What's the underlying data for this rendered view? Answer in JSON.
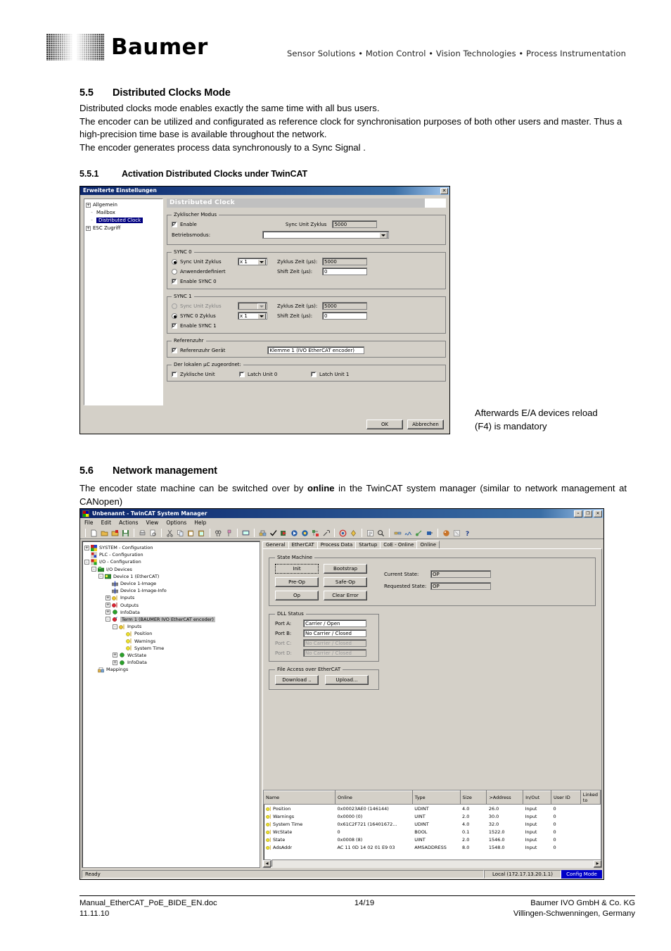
{
  "header": {
    "brand": "Baumer",
    "tagline": "Sensor Solutions • Motion Control • Vision Technologies • Process Instrumentation"
  },
  "sections": {
    "s55": {
      "number": "5.5",
      "title": "Distributed Clocks Mode",
      "p1": "Distributed clocks mode enables exactly the same time with all bus users.",
      "p2": "The encoder can be utilized and configurated as reference clock for synchronisation purposes of both other users and master. Thus a high-precision time base is available throughout the network.",
      "p3": "The encoder generates process data synchronously to a Sync Signal ."
    },
    "s551": {
      "number": "5.5.1",
      "title": "Activation Distributed Clocks under TwinCAT"
    },
    "s56": {
      "number": "5.6",
      "title": "Network management",
      "p1a": "The encoder state machine can be switched over by ",
      "p1b": "online",
      "p1c": " in the TwinCAT system manager (similar to network management at CANopen)"
    }
  },
  "note": "Afterwards E/A devices reload\n(F4) is mandatory",
  "dialog1": {
    "title": "Erweiterte Einstellungen",
    "close_label": "✕",
    "tree": [
      {
        "label": "Allgemein",
        "expander": "+",
        "selected": false
      },
      {
        "label": "Mailbox",
        "expander": "",
        "selected": false
      },
      {
        "label": "Distributed Clock",
        "expander": "",
        "selected": true
      },
      {
        "label": "ESC Zugriff",
        "expander": "+",
        "selected": false
      }
    ],
    "pane_title": "Distributed Clock",
    "cyclic": {
      "legend": "Zyklischer Modus",
      "enable_label": "Enable",
      "enable_checked": true,
      "sync_unit_cycle_label": "Sync Unit Zyklus",
      "sync_unit_cycle_value": "5000",
      "mode_label": "Betriebsmodus:",
      "mode_value": ""
    },
    "sync0": {
      "legend": "SYNC 0",
      "opt1_label": "Sync Unit Zyklus",
      "opt1_selected": true,
      "opt1_combo": "x 1",
      "opt2_label": "Anwenderdefiniert",
      "opt2_selected": false,
      "cycle_time_label": "Zyklus Zeit (µs):",
      "cycle_time_value": "5000",
      "shift_time_label": "Shift Zeit (µs):",
      "shift_time_value": "0",
      "enable_label": "Enable SYNC 0",
      "enable_checked": true
    },
    "sync1": {
      "legend": "SYNC 1",
      "opt1_label": "Sync Unit Zyklus",
      "opt1_selected": false,
      "opt1_combo": "",
      "opt2_label": "SYNC 0 Zyklus",
      "opt2_selected": true,
      "opt2_combo": "x 1",
      "cycle_time_label": "Zyklus Zeit (µs):",
      "cycle_time_value": "5000",
      "shift_time_label": "Shift Zeit (µs):",
      "shift_time_value": "0",
      "enable_label": "Enable SYNC 1",
      "enable_checked": true
    },
    "refclock": {
      "legend": "Referenzuhr",
      "device_label": "Referenzuhr Gerät",
      "device_checked": true,
      "device_value": "Klemme 1 (IVO EtherCAT encoder)"
    },
    "localuc": {
      "legend": "Der lokalen µC zugeordnet:",
      "items": [
        {
          "label": "Zyklische Unit",
          "checked": false
        },
        {
          "label": "Latch Unit 0",
          "checked": false
        },
        {
          "label": "Latch Unit 1",
          "checked": false
        }
      ]
    },
    "ok_label": "OK",
    "cancel_label": "Abbrechen"
  },
  "twincat": {
    "title": "Unbenannt - TwinCAT System Manager",
    "window_buttons": [
      "–",
      "❐",
      "✕"
    ],
    "menu": [
      "File",
      "Edit",
      "Actions",
      "View",
      "Options",
      "Help"
    ],
    "tree": [
      {
        "depth": 0,
        "expander": "+",
        "label": "SYSTEM - Configuration",
        "icon": "system-icon",
        "selected": false
      },
      {
        "depth": 0,
        "expander": "",
        "label": "PLC - Configuration",
        "icon": "plc-icon",
        "selected": false
      },
      {
        "depth": 0,
        "expander": "-",
        "label": "I/O - Configuration",
        "icon": "io-icon",
        "selected": false
      },
      {
        "depth": 1,
        "expander": "-",
        "label": "I/O Devices",
        "icon": "devices-icon",
        "selected": false
      },
      {
        "depth": 2,
        "expander": "-",
        "label": "Device 1 (EtherCAT)",
        "icon": "device-icon",
        "selected": false
      },
      {
        "depth": 3,
        "expander": "",
        "label": "Device 1-Image",
        "icon": "image-icon",
        "selected": false
      },
      {
        "depth": 3,
        "expander": "",
        "label": "Device 1-Image-Info",
        "icon": "image-icon",
        "selected": false
      },
      {
        "depth": 3,
        "expander": "+",
        "label": "Inputs",
        "icon": "inputs-icon",
        "selected": false
      },
      {
        "depth": 3,
        "expander": "+",
        "label": "Outputs",
        "icon": "outputs-icon",
        "selected": false
      },
      {
        "depth": 3,
        "expander": "+",
        "label": "InfoData",
        "icon": "infodata-icon",
        "selected": false
      },
      {
        "depth": 3,
        "expander": "-",
        "label": "Term 1 (BAUMER IVO EtherCAT encoder)",
        "icon": "term-icon",
        "selected": true
      },
      {
        "depth": 4,
        "expander": "-",
        "label": "Inputs",
        "icon": "inputs-icon",
        "selected": false
      },
      {
        "depth": 5,
        "expander": "",
        "label": "Position",
        "icon": "var-icon",
        "selected": false
      },
      {
        "depth": 5,
        "expander": "",
        "label": "Warnings",
        "icon": "var-icon",
        "selected": false
      },
      {
        "depth": 5,
        "expander": "",
        "label": "System Time",
        "icon": "var-icon",
        "selected": false
      },
      {
        "depth": 4,
        "expander": "+",
        "label": "WcState",
        "icon": "infodata-icon",
        "selected": false
      },
      {
        "depth": 4,
        "expander": "+",
        "label": "InfoData",
        "icon": "infodata-icon",
        "selected": false
      },
      {
        "depth": 1,
        "expander": "",
        "label": "Mappings",
        "icon": "mappings-icon",
        "selected": false
      }
    ],
    "tabs": [
      {
        "label": "General",
        "active": false
      },
      {
        "label": "EtherCAT",
        "active": false
      },
      {
        "label": "Process Data",
        "active": false
      },
      {
        "label": "Startup",
        "active": false
      },
      {
        "label": "CoE - Online",
        "active": false
      },
      {
        "label": "Online",
        "active": true
      }
    ],
    "state_machine": {
      "legend": "State Machine",
      "buttons": [
        "Init",
        "Bootstrap",
        "Pre-Op",
        "Safe-Op",
        "Op",
        "Clear Error"
      ],
      "current_state_label": "Current State:",
      "current_state_value": "OP",
      "requested_state_label": "Requested State:",
      "requested_state_value": "OP"
    },
    "dll_status": {
      "legend": "DLL Status",
      "ports": [
        {
          "label": "Port A:",
          "value": "Carrier / Open",
          "disabled": false
        },
        {
          "label": "Port B:",
          "value": "No Carrier / Closed",
          "disabled": false
        },
        {
          "label": "Port C:",
          "value": "No Carrier / Closed",
          "disabled": true
        },
        {
          "label": "Port D:",
          "value": "No Carrier / Closed",
          "disabled": true
        }
      ]
    },
    "file_access": {
      "legend": "File Access over EtherCAT",
      "download_label": "Download ..",
      "upload_label": "Upload..."
    },
    "grid": {
      "columns": [
        "Name",
        "Online",
        "Type",
        "Size",
        ">Address",
        "In/Out",
        "User ID",
        "Linked to"
      ],
      "rows": [
        {
          "name": "Position",
          "online": "0x00023AE0 (146144)",
          "type": "UDINT",
          "size": "4.0",
          "address": "26.0",
          "inout": "Input",
          "userid": "0",
          "linked": ""
        },
        {
          "name": "Warnings",
          "online": "0x0000 (0)",
          "type": "UINT",
          "size": "2.0",
          "address": "30.0",
          "inout": "Input",
          "userid": "0",
          "linked": ""
        },
        {
          "name": "System Time",
          "online": "0x61C2F721 (16401672...",
          "type": "UDINT",
          "size": "4.0",
          "address": "32.0",
          "inout": "Input",
          "userid": "0",
          "linked": ""
        },
        {
          "name": "WcState",
          "online": "0",
          "type": "BOOL",
          "size": "0.1",
          "address": "1522.0",
          "inout": "Input",
          "userid": "0",
          "linked": ""
        },
        {
          "name": "State",
          "online": "0x0008 (8)",
          "type": "UINT",
          "size": "2.0",
          "address": "1546.0",
          "inout": "Input",
          "userid": "0",
          "linked": ""
        },
        {
          "name": "AdsAddr",
          "online": "AC 11 0D 14 02 01 E9 03",
          "type": "AMSADDRESS",
          "size": "8.0",
          "address": "1548.0",
          "inout": "Input",
          "userid": "0",
          "linked": ""
        }
      ]
    },
    "status_bar": {
      "ready": "Ready",
      "local": "Local (172.17.13.20.1.1)",
      "mode": "Config Mode"
    }
  },
  "footer": {
    "doc": "Manual_EtherCAT_PoE_BIDE_EN.doc",
    "date": "11.11.10",
    "page": "14/19",
    "company": "Baumer IVO GmbH & Co. KG",
    "city": "Villingen-Schwenningen, Germany"
  },
  "colors": {
    "titlebar": "#0a246a",
    "dialog_face": "#d4d0c8",
    "selection": "#000080",
    "status_blue": "#0000c8"
  }
}
